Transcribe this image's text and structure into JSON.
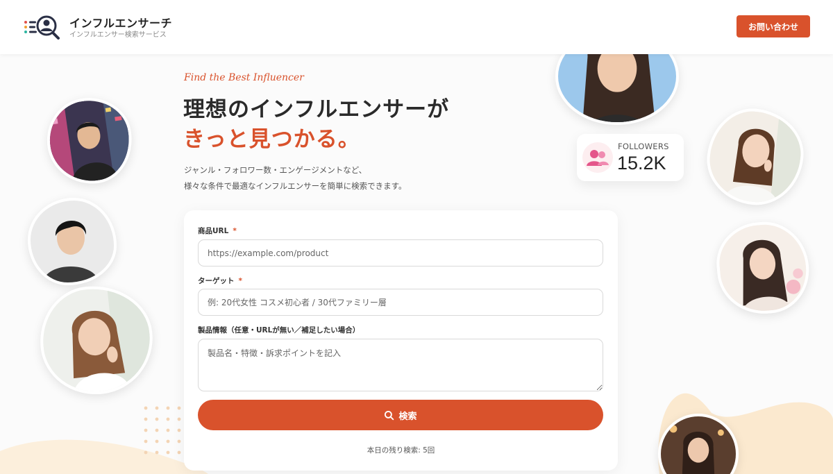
{
  "header": {
    "brand_title": "インフルエンサーチ",
    "brand_subtitle": "インフルエンサー検索サービス",
    "contact_button": "お問い合わせ"
  },
  "hero": {
    "tagline": "Find the Best Influencer",
    "headline_line1": "理想のインフルエンサーが",
    "headline_line2": "きっと見つかる。",
    "description_line1": "ジャンル・フォロワー数・エンゲージメントなど、",
    "description_line2": "様々な条件で最適なインフルエンサーを簡単に検索できます。"
  },
  "followers_card": {
    "label": "FOLLOWERS",
    "value": "15.2K",
    "icon": "users-icon"
  },
  "form": {
    "product_url": {
      "label": "商品URL",
      "required_mark": "*",
      "placeholder": "https://example.com/product",
      "value": ""
    },
    "target": {
      "label": "ターゲット",
      "required_mark": "*",
      "placeholder": "例: 20代女性 コスメ初心者 / 30代ファミリー層",
      "value": ""
    },
    "product_info": {
      "label": "製品情報（任意・URLが無い／補足したい場合）",
      "placeholder": "製品名・特徴・訴求ポイントを記入",
      "value": ""
    },
    "search_button": "検索",
    "search_icon": "search-icon",
    "remaining_searches": "本日の残り検索: 5回"
  },
  "colors": {
    "accent": "#d9522c",
    "background": "#fbfbfb",
    "blob": "#fbe9cf"
  }
}
